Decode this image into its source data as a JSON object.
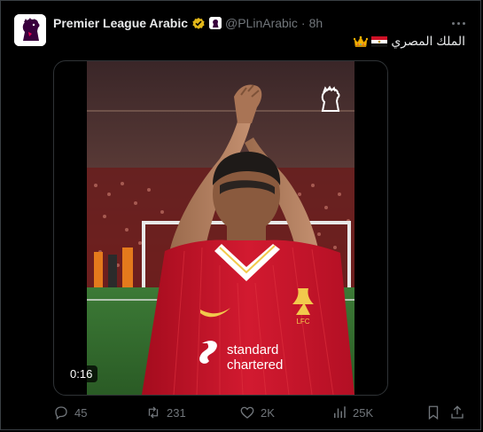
{
  "tweet": {
    "display_name": "Premier League Arabic",
    "handle": "@PLinArabic",
    "separator": "·",
    "time": "8h",
    "text": "الملك المصري",
    "emoji": [
      "egypt-flag",
      "crown"
    ]
  },
  "media": {
    "duration": "0:16",
    "jersey_sponsor": [
      "standard",
      "chartered"
    ],
    "crest_text": "LFC"
  },
  "actions": {
    "replies": "45",
    "reposts": "231",
    "likes": "2K",
    "views": "25K"
  },
  "colors": {
    "background": "#000000",
    "text_primary": "#e7e9ea",
    "text_secondary": "#71767b",
    "verified_gold": "#e2b719",
    "jersey_red": "#c8102e",
    "pitch_green": "#2f6b2d"
  },
  "icons": [
    "avatar",
    "verified-badge-icon",
    "affiliate-badge-icon",
    "more-icon",
    "crown-emoji",
    "egypt-flag-emoji",
    "premier-league-lion-icon",
    "reply-icon",
    "repost-icon",
    "like-icon",
    "views-icon",
    "bookmark-icon",
    "share-icon"
  ]
}
